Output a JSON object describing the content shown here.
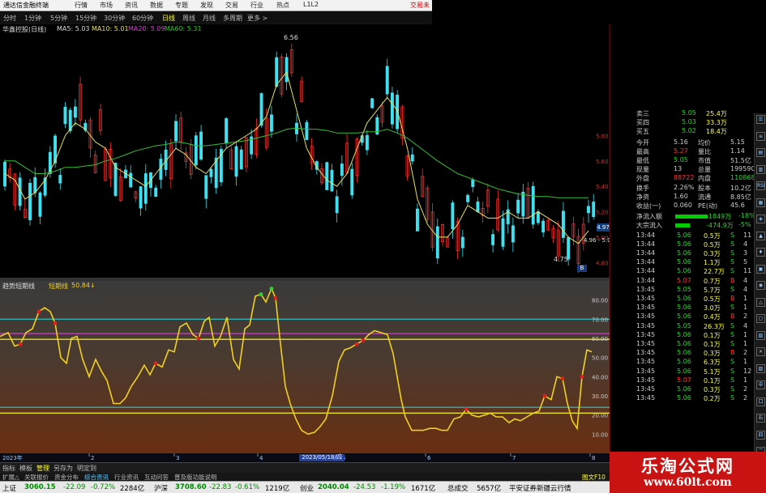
{
  "menu": {
    "title": "通达信金融终端",
    "items": [
      "行情",
      "市场",
      "资讯",
      "数据",
      "专题",
      "发现",
      "交易",
      "行业",
      "热点",
      "L1L2"
    ],
    "right": "交易未"
  },
  "periods": [
    "分时",
    "1分钟",
    "5分钟",
    "15分钟",
    "30分钟",
    "60分钟",
    "日线",
    "周线",
    "月线",
    "多周期",
    "更多 >"
  ],
  "periods_active": "日线",
  "main_chart": {
    "stock_label": "华鑫控股(日线)",
    "ma_legend": [
      {
        "label": "MA5: 5.03",
        "color": "#d8d8d8"
      },
      {
        "label": "MA10: 5.01",
        "color": "#e8e060"
      },
      {
        "label": "MA20: 5.09",
        "color": "#d040d0"
      },
      {
        "label": "MA60: 5.31",
        "color": "#30c030"
      }
    ],
    "price_ticks": [
      "5.80",
      "5.60",
      "5.40",
      "5.20",
      "5.00",
      "4.80"
    ],
    "high_label": "6.56",
    "low_label": "4.75",
    "cur_label": "4.97",
    "prev_label": "4.96 - 5.0",
    "marker_label": "B"
  },
  "indicator": {
    "name": "趋势短期线",
    "sub_label": "短期线",
    "value": "50.84↓",
    "y_ticks": [
      "80.00",
      "70.00",
      "60.00",
      "50.00",
      "40.00",
      "30.00",
      "20.00",
      "10.00"
    ],
    "date_label": "2023/05/18/四",
    "year_label": "2023年",
    "months": [
      "2",
      "3",
      "4",
      "5",
      "6",
      "7",
      "8"
    ]
  },
  "quote": {
    "asks": [
      {
        "label": "卖三",
        "price": "5.05",
        "vol": "25.4万"
      },
      {
        "label": "买四",
        "price": "5.03",
        "vol": "33.3万"
      },
      {
        "label": "买五",
        "price": "5.02",
        "vol": "18.4万"
      }
    ],
    "stats": [
      {
        "l1": "今开",
        "v1": "5.16",
        "l2": "均价",
        "v2": "5.15"
      },
      {
        "l1": "最高",
        "v1": "5.27",
        "l2": "量比",
        "v2": "1.14"
      },
      {
        "l1": "最低",
        "v1": "5.05",
        "l2": "市值",
        "v2": "51.5亿"
      },
      {
        "l1": "现量",
        "v1": "13",
        "l2": "总量",
        "v2": "199590"
      },
      {
        "l1": "外盘",
        "v1": "88722",
        "l2": "内盘",
        "v2": "110868"
      },
      {
        "l1": "换手",
        "v1": "2.26%",
        "l2": "股本",
        "v2": "10.2亿"
      },
      {
        "l1": "净资",
        "v1": "1.60",
        "l2": "流通",
        "v2": "8.85亿"
      },
      {
        "l1": "收益(一)",
        "v1": "0.060",
        "l2": "PE(动)",
        "v2": "45.6"
      }
    ],
    "flows": [
      {
        "label": "净流入额",
        "value": "-1849万",
        "pct": "-18%"
      },
      {
        "label": "大宗流入",
        "value": "-474.9万",
        "pct": "-5%"
      }
    ],
    "ticks": [
      {
        "t": "13:44",
        "p": "5.06",
        "v": "0.5万",
        "d": "S",
        "n": "11"
      },
      {
        "t": "13:44",
        "p": "5.06",
        "v": "0.5万",
        "d": "S",
        "n": "4"
      },
      {
        "t": "13:44",
        "p": "5.06",
        "v": "0.3万",
        "d": "S",
        "n": "3"
      },
      {
        "t": "13:44",
        "p": "5.06",
        "v": "1.1万",
        "d": "S",
        "n": "5"
      },
      {
        "t": "13:44",
        "p": "5.06",
        "v": "22.7万",
        "d": "S",
        "n": "11"
      },
      {
        "t": "13:44",
        "p": "5.07",
        "v": "0.7万",
        "d": "B",
        "n": "4"
      },
      {
        "t": "13:45",
        "p": "5.05",
        "v": "5.7万",
        "d": "S",
        "n": "4"
      },
      {
        "t": "13:45",
        "p": "5.06",
        "v": "0.5万",
        "d": "B",
        "n": "1"
      },
      {
        "t": "13:45",
        "p": "5.06",
        "v": "3.0万",
        "d": "S",
        "n": "1"
      },
      {
        "t": "13:45",
        "p": "5.06",
        "v": "0.4万",
        "d": "B",
        "n": "2"
      },
      {
        "t": "13:45",
        "p": "5.05",
        "v": "26.3万",
        "d": "S",
        "n": "4"
      },
      {
        "t": "13:45",
        "p": "5.06",
        "v": "0.1万",
        "d": "S",
        "n": "1"
      },
      {
        "t": "13:45",
        "p": "5.06",
        "v": "0.1万",
        "d": "S",
        "n": "1"
      },
      {
        "t": "13:45",
        "p": "5.06",
        "v": "0.3万",
        "d": "B",
        "n": "2"
      },
      {
        "t": "13:45",
        "p": "5.06",
        "v": "6.3万",
        "d": "S",
        "n": "1"
      },
      {
        "t": "13:45",
        "p": "5.06",
        "v": "5.1万",
        "d": "S",
        "n": "12"
      },
      {
        "t": "13:45",
        "p": "5.07",
        "v": "0.1万",
        "d": "S",
        "n": "1"
      },
      {
        "t": "13:45",
        "p": "5.06",
        "v": "0.3万",
        "d": "S",
        "n": "2"
      },
      {
        "t": "13:45",
        "p": "5.06",
        "v": "0.2万",
        "d": "S",
        "n": "2"
      }
    ]
  },
  "side_toolbar": [
    "☰",
    "≡",
    "▤",
    "▥",
    "RSI",
    "▦",
    "◈",
    "▲",
    "♦",
    "▣",
    "◉",
    "△",
    "▢",
    "▧",
    "✕",
    "▨",
    "中",
    "口",
    "右",
    "四",
    "二"
  ],
  "bottom_tabs": {
    "row1": [
      "指标",
      "模板",
      "管理",
      "另存为",
      "明定到"
    ],
    "row1_active": "管理",
    "row2": [
      "扩展△",
      "关联报价",
      "资金分布",
      "综合资讯",
      "行业资讯",
      "互动问答",
      "普及版功能说明"
    ],
    "right_label": "图文F10"
  },
  "status": [
    {
      "label": "上证",
      "value": "3060.15",
      "chg": "-22.09",
      "pct": "-0.72%",
      "amt": "2284亿"
    },
    {
      "label": "沪深",
      "value": "3708.60",
      "chg": "-22.83",
      "pct": "-0.61%",
      "amt": "1219亿"
    },
    {
      "label": "创业",
      "value": "2040.04",
      "chg": "-24.53",
      "pct": "-1.19%",
      "amt": "1671亿"
    }
  ],
  "status_total": {
    "label": "总成交",
    "value": "5657亿",
    "note": "平安证券新疆云行情"
  },
  "watermark": {
    "cn": "乐淘公式网",
    "url": "www.60lt.com"
  },
  "chart_data": {
    "type": "line",
    "title": "趋势短期线",
    "ylim": [
      0,
      90
    ],
    "x": [
      0,
      10,
      18,
      25,
      32,
      40,
      48,
      55,
      62,
      68,
      75,
      82,
      88,
      95,
      102,
      110,
      118,
      125,
      132,
      140,
      148,
      155,
      162,
      170,
      178,
      185,
      192,
      200,
      208,
      215,
      222,
      230,
      238,
      245,
      252,
      258,
      265,
      272,
      280,
      288,
      295,
      302,
      308,
      315,
      322,
      328,
      335,
      340,
      345,
      352,
      358,
      365,
      372,
      380,
      388,
      395,
      402,
      410,
      418,
      425,
      432,
      440,
      448,
      455,
      462,
      470,
      478,
      485,
      490,
      495,
      500,
      508,
      515,
      522,
      530,
      538,
      545,
      552,
      560,
      568,
      575,
      582,
      590,
      598,
      605,
      612,
      620,
      628,
      635,
      642,
      650,
      658,
      665,
      672,
      680,
      687,
      694,
      700,
      706,
      712,
      718,
      724,
      730
    ],
    "values": [
      61,
      63,
      56,
      57,
      63,
      65,
      74,
      76,
      74,
      68,
      50,
      47,
      60,
      61,
      49,
      40,
      49,
      43,
      38,
      26,
      26,
      29,
      35,
      40,
      46,
      41,
      47,
      45,
      54,
      53,
      66,
      68,
      62,
      60,
      69,
      71,
      56,
      61,
      71,
      49,
      44,
      65,
      67,
      82,
      83,
      79,
      86,
      81,
      61,
      35,
      26,
      18,
      12,
      10,
      11,
      14,
      18,
      30,
      48,
      54,
      55,
      57,
      59,
      62,
      64,
      63,
      62,
      52,
      40,
      28,
      19,
      12,
      12,
      12,
      13,
      13,
      12,
      12,
      18,
      19,
      23,
      20,
      19,
      20,
      21,
      19,
      19,
      16,
      18,
      17,
      19,
      21,
      22,
      30,
      28,
      40,
      39,
      26,
      17,
      13,
      40,
      54,
      53
    ],
    "levels": [
      {
        "name": "yellow",
        "value": 59.5,
        "color": "#e8e020"
      },
      {
        "name": "magenta",
        "value": 62.5,
        "color": "#c040c0"
      },
      {
        "name": "cyan-high",
        "value": 70,
        "color": "#30b0b0"
      },
      {
        "name": "cyan-low",
        "value": 24,
        "color": "#30b0b0"
      },
      {
        "name": "yellow-low",
        "value": 21,
        "color": "#e8e020"
      }
    ],
    "price_series": {
      "type": "candlestick",
      "ylim": [
        4.7,
        6.6
      ],
      "ma5": [
        5.5,
        5.45,
        5.3,
        5.35,
        5.45,
        5.6,
        5.8,
        5.9,
        5.85,
        5.75,
        5.7,
        5.55,
        5.5,
        5.45,
        5.4,
        5.5,
        5.6,
        5.7,
        5.65,
        5.55,
        5.5,
        5.6,
        5.7,
        5.75,
        5.8,
        5.85,
        5.95,
        6.2,
        6.3,
        6.0,
        5.7,
        5.55,
        5.45,
        5.4,
        5.5,
        5.7,
        5.9,
        6.0,
        6.1,
        6.0,
        5.7,
        5.3,
        5.1,
        5.0,
        5.0,
        5.1,
        5.25,
        5.2,
        5.15,
        5.15,
        5.2,
        5.15,
        5.15,
        5.2,
        5.15,
        5.1,
        5.0,
        4.95,
        5.05
      ],
      "ma60": [
        5.6,
        5.6,
        5.55,
        5.5,
        5.5,
        5.52,
        5.55,
        5.55,
        5.56,
        5.57,
        5.6,
        5.62,
        5.65,
        5.68,
        5.7,
        5.72,
        5.73,
        5.75,
        5.74,
        5.72,
        5.72,
        5.73,
        5.74,
        5.75,
        5.76,
        5.78,
        5.8,
        5.82,
        5.85,
        5.86,
        5.85,
        5.85,
        5.84,
        5.82,
        5.82,
        5.82,
        5.83,
        5.83,
        5.85,
        5.82,
        5.78,
        5.72,
        5.66,
        5.6,
        5.55,
        5.5,
        5.47,
        5.44,
        5.41,
        5.38,
        5.36,
        5.34,
        5.33,
        5.32,
        5.32,
        5.31,
        5.31,
        5.31,
        5.31
      ]
    }
  }
}
